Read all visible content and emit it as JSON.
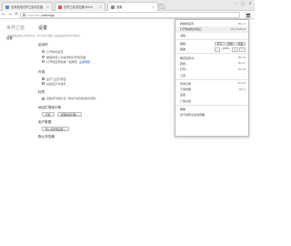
{
  "tabs": [
    {
      "label": "没有使用世界之窗浏览器",
      "color": "#4a90d9"
    },
    {
      "label": "世界之窗浏览器(Wind",
      "color": "#d9534f"
    },
    {
      "label": "设置",
      "color": "#888888"
    }
  ],
  "window_controls": {
    "minimize": "–",
    "maximize": "□",
    "close": "✕"
  },
  "toolbar": {
    "back": "←",
    "forward": "→",
    "reload": "⟳",
    "url_scheme": "chrome://",
    "url_host": "settings"
  },
  "leftnav": {
    "brand": "世界之窗",
    "items": [
      "设置",
      "历史",
      "扩展",
      "帮助"
    ]
  },
  "main": {
    "title": "设置",
    "banner": "当前页面设置仅对本地有效，可在其他计算机上修改此设置后同步到此处",
    "startup": {
      "heading": "启动时",
      "options": [
        {
          "label": "打开新标签页",
          "checked": true
        },
        {
          "label": "继续浏览上次关闭时打开的页面",
          "checked": false
        },
        {
          "label": "打开特定网页或一组网页",
          "checked": false,
          "link": "设置网页"
        }
      ]
    },
    "appearance": {
      "heading": "外观",
      "options": [
        {
          "label": "显示\"主页\"按钮",
          "checked": false
        },
        {
          "label": "总是显示书签栏",
          "checked": false
        }
      ]
    },
    "search": {
      "heading": "标签",
      "options": [
        {
          "label": "当使用开启新标签（地址栏中的搜索建议预测）",
          "checked": false
        }
      ]
    },
    "default_search": {
      "heading": "地址栏搜索引擎",
      "buttons": [
        "百度",
        "管理搜索引擎..."
      ]
    },
    "users": {
      "heading": "用户数据",
      "buttons": [
        "导入书签和设置..."
      ]
    },
    "default_browser": {
      "heading": "默认浏览器"
    }
  },
  "menu": {
    "items": [
      {
        "label": "新建标签页",
        "shortcut": "Ctrl+T"
      },
      {
        "label": "打开新的隐身窗口",
        "shortcut": "Ctrl+Shift+N"
      },
      {
        "label": "书签",
        "shortcut": ""
      },
      {
        "sep": true
      },
      {
        "label": "编辑",
        "shortcut": "",
        "zoom": true
      },
      {
        "label": "缩放",
        "shortcut": "",
        "zoomrow": true
      },
      {
        "sep": true
      },
      {
        "label": "网页另存为...",
        "shortcut": "Ctrl+S"
      },
      {
        "label": "查找...",
        "shortcut": "Ctrl+F"
      },
      {
        "label": "打印...",
        "shortcut": "Ctrl+P"
      },
      {
        "label": "工具",
        "shortcut": ""
      },
      {
        "sep": true
      },
      {
        "label": "历史记录",
        "shortcut": "Ctrl+H"
      },
      {
        "label": "下载内容",
        "shortcut": "Ctrl+J"
      },
      {
        "label": "设置",
        "shortcut": ""
      },
      {
        "label": "广告过滤",
        "shortcut": ""
      },
      {
        "sep": true
      },
      {
        "label": "帮助",
        "shortcut": ""
      },
      {
        "label": "关于世界之窗浏览器",
        "shortcut": ""
      }
    ],
    "zoom": {
      "minus": "-",
      "value": "100%",
      "plus": "+",
      "full": "⛶"
    },
    "edit": {
      "cut": "剪切",
      "copy": "复制",
      "paste": "粘贴"
    }
  }
}
